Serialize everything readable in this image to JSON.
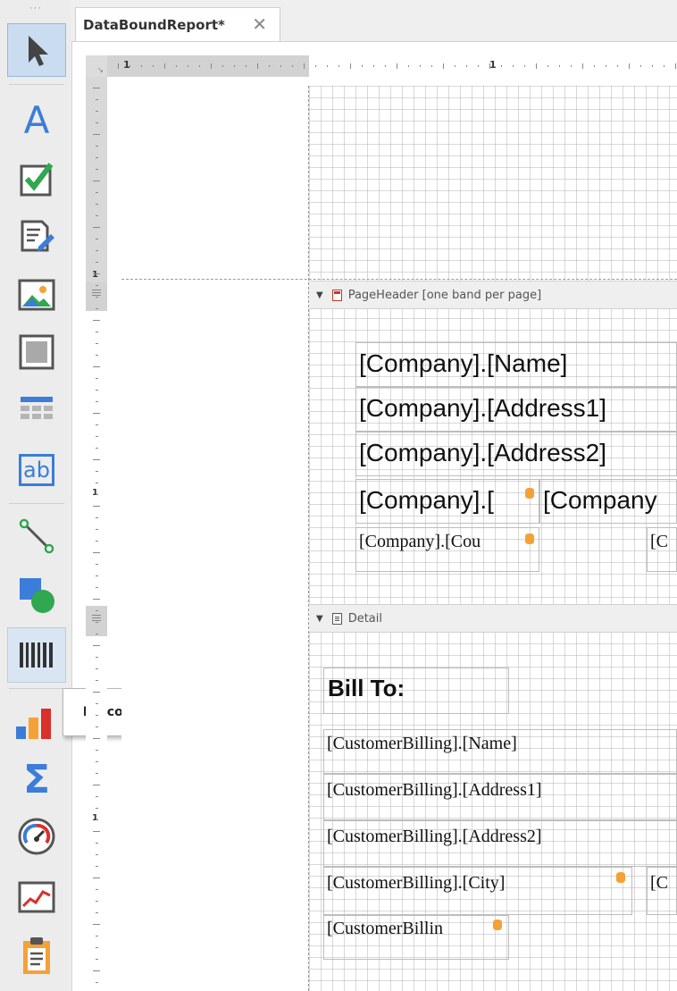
{
  "toolbox": {
    "grip": "···",
    "tools": [
      {
        "name": "pointer-tool",
        "icon": "pointer-icon"
      },
      {
        "name": "label-tool",
        "icon": "label-icon",
        "glyph": "A"
      },
      {
        "name": "checkbox-tool",
        "icon": "checkbox-icon"
      },
      {
        "name": "richtext-tool",
        "icon": "richtext-icon"
      },
      {
        "name": "picture-tool",
        "icon": "picture-icon"
      },
      {
        "name": "panel-tool",
        "icon": "panel-icon"
      },
      {
        "name": "table-tool",
        "icon": "table-icon"
      },
      {
        "name": "character-comb-tool",
        "icon": "character-comb-icon",
        "glyph": "ab"
      },
      {
        "name": "line-tool",
        "icon": "line-icon"
      },
      {
        "name": "shape-tool",
        "icon": "shape-icon"
      },
      {
        "name": "barcode-tool",
        "icon": "barcode-icon"
      },
      {
        "name": "chart-tool",
        "icon": "chart-icon"
      },
      {
        "name": "summary-tool",
        "icon": "sigma-icon",
        "glyph": "Σ"
      },
      {
        "name": "gauge-tool",
        "icon": "gauge-icon"
      },
      {
        "name": "sparkline-tool",
        "icon": "sparkline-icon"
      },
      {
        "name": "subreport-tool",
        "icon": "subreport-icon"
      }
    ],
    "tooltip": "Barcode"
  },
  "tabs": [
    {
      "label": "DataBoundReport*",
      "close": "✕"
    }
  ],
  "ruler": {
    "corner": "↘",
    "h_numbers": [
      "1",
      "1"
    ],
    "v_numbers": [
      "1",
      "1",
      "1"
    ]
  },
  "bands": {
    "page_header": {
      "label": "PageHeader [one band per page]",
      "arrow": "▼"
    },
    "detail": {
      "label": "Detail",
      "arrow": "▼"
    }
  },
  "page_header_fields": [
    "[Company].[Name]",
    "[Company].[Address1]",
    "[Company].[Address2]",
    "[Company].[",
    "[Company",
    "[Company].[Cou",
    "[C"
  ],
  "detail_fields": [
    "Bill To:",
    "[CustomerBilling].[Name]",
    "[CustomerBilling].[Address1]",
    "[CustomerBilling].[Address2]",
    "[CustomerBilling].[City]",
    "[C",
    "[CustomerBillin"
  ],
  "colors": {
    "accent": "#3b7dd8",
    "selection": "#c9dcf0",
    "db_icon": "#f4a136"
  }
}
